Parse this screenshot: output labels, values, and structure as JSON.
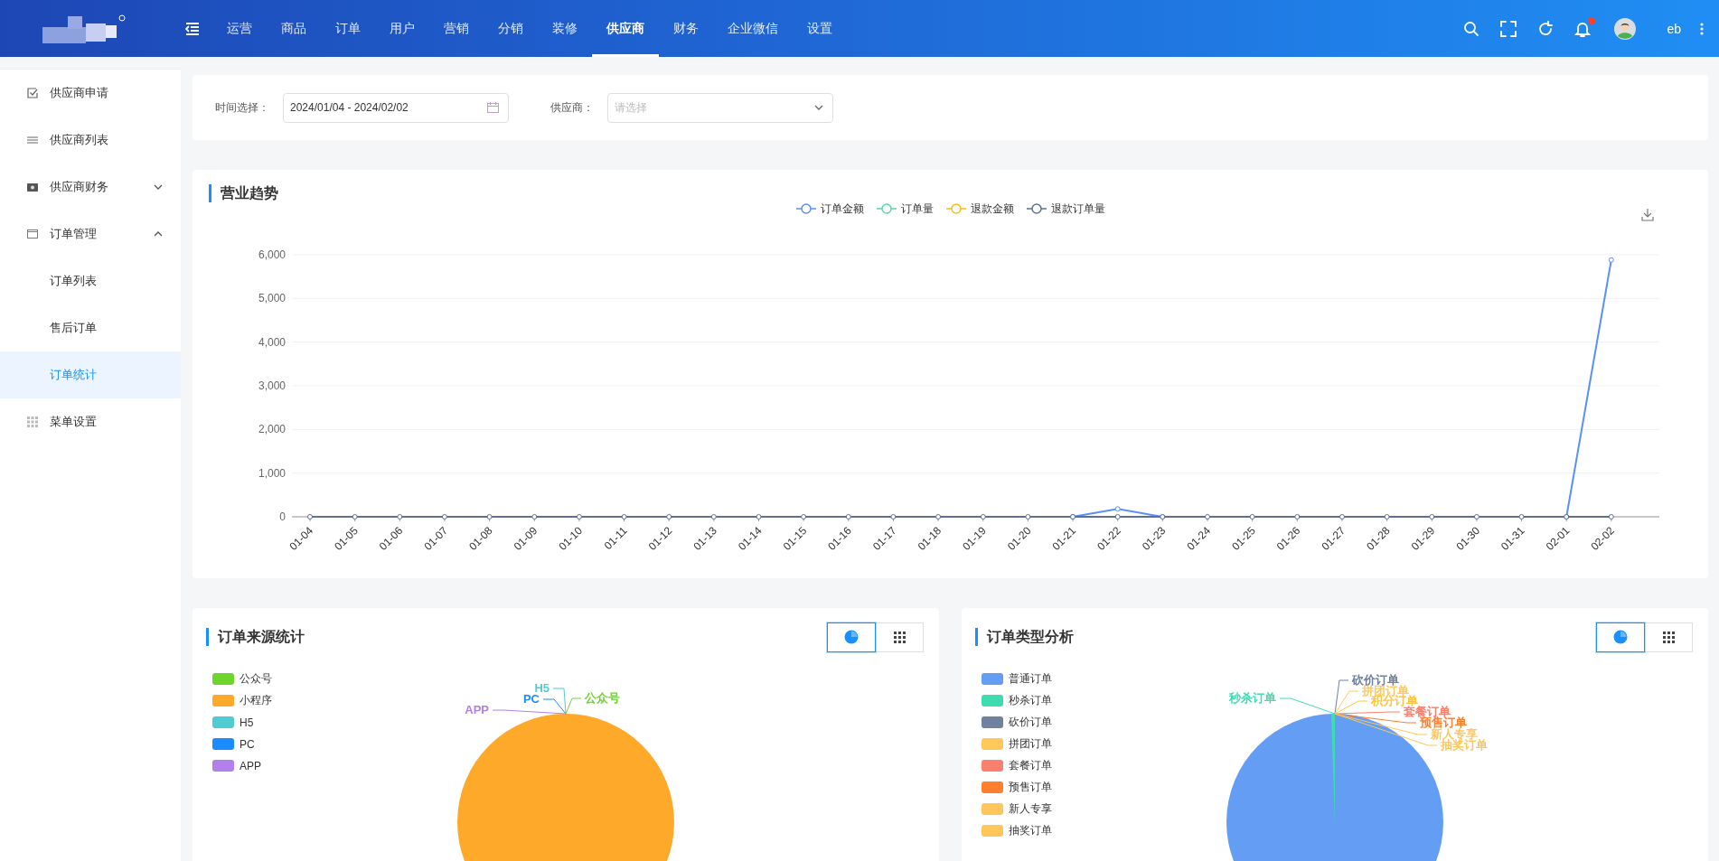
{
  "topbar": {
    "nav": [
      {
        "label": "运营",
        "selected": false
      },
      {
        "label": "商品",
        "selected": false
      },
      {
        "label": "订单",
        "selected": false
      },
      {
        "label": "用户",
        "selected": false
      },
      {
        "label": "营销",
        "selected": false
      },
      {
        "label": "分销",
        "selected": false
      },
      {
        "label": "装修",
        "selected": false
      },
      {
        "label": "供应商",
        "selected": true
      },
      {
        "label": "财务",
        "selected": false
      },
      {
        "label": "企业微信",
        "selected": false
      },
      {
        "label": "设置",
        "selected": false
      }
    ],
    "has_unread": true,
    "user": {
      "name": "eb"
    }
  },
  "sidebar": {
    "items": [
      {
        "label": "供应商申请",
        "selected": false
      },
      {
        "label": "供应商列表",
        "selected": false
      },
      {
        "label": "供应商财务",
        "selected": false,
        "expanded": false
      },
      {
        "label": "订单管理",
        "selected": false,
        "expanded": true,
        "children": [
          {
            "label": "订单列表",
            "selected": false
          },
          {
            "label": "售后订单",
            "selected": false
          },
          {
            "label": "订单统计",
            "selected": true
          }
        ]
      },
      {
        "label": "菜单设置",
        "selected": false
      }
    ]
  },
  "filters": {
    "date_range": {
      "label": "时间选择：",
      "value": "2024/01/04 - 2024/02/02"
    },
    "supplier": {
      "label": "供应商：",
      "placeholder": "请选择"
    }
  },
  "trend": {
    "title": "营业趋势",
    "chart_data": {
      "type": "line",
      "categories": [
        "01-04",
        "01-05",
        "01-06",
        "01-07",
        "01-08",
        "01-09",
        "01-10",
        "01-11",
        "01-12",
        "01-13",
        "01-14",
        "01-15",
        "01-16",
        "01-17",
        "01-18",
        "01-19",
        "01-20",
        "01-21",
        "01-22",
        "01-23",
        "01-24",
        "01-25",
        "01-26",
        "01-27",
        "01-28",
        "01-29",
        "01-30",
        "01-31",
        "02-01",
        "02-02"
      ],
      "series": [
        {
          "name": "订单金额",
          "color": "#5b8ff9",
          "marker": true,
          "values": [
            null,
            null,
            null,
            null,
            null,
            null,
            null,
            null,
            null,
            null,
            null,
            null,
            null,
            null,
            null,
            null,
            null,
            0,
            180,
            0,
            null,
            null,
            null,
            null,
            null,
            null,
            null,
            null,
            0,
            5880
          ]
        },
        {
          "name": "订单量",
          "color": "#5ad8a6",
          "values": [
            null,
            null,
            null,
            null,
            null,
            null,
            null,
            null,
            null,
            null,
            null,
            null,
            null,
            null,
            null,
            null,
            null,
            null,
            null,
            null,
            null,
            null,
            null,
            null,
            null,
            null,
            null,
            null,
            null,
            null
          ]
        },
        {
          "name": "退款金额",
          "color": "#f6bd16",
          "values": [
            null,
            null,
            null,
            null,
            null,
            null,
            null,
            null,
            null,
            null,
            null,
            null,
            null,
            null,
            null,
            null,
            null,
            null,
            null,
            null,
            null,
            null,
            null,
            null,
            null,
            null,
            null,
            null,
            null,
            null
          ]
        },
        {
          "name": "退款订单量",
          "color": "#5d7092",
          "marker": true,
          "values": [
            0,
            0,
            0,
            0,
            0,
            0,
            0,
            0,
            0,
            0,
            0,
            0,
            0,
            0,
            0,
            0,
            0,
            0,
            0,
            0,
            0,
            0,
            0,
            0,
            0,
            0,
            0,
            0,
            0,
            0
          ]
        }
      ],
      "grid": true,
      "ylim": [
        0,
        6000
      ],
      "yticks": [
        {
          "value": 0,
          "label": "0"
        },
        {
          "value": 1000,
          "label": "1,000"
        },
        {
          "value": 2000,
          "label": "2,000"
        },
        {
          "value": 3000,
          "label": "3,000"
        },
        {
          "value": 4000,
          "label": "4,000"
        },
        {
          "value": 5000,
          "label": "5,000"
        },
        {
          "value": 6000,
          "label": "6,000"
        }
      ]
    }
  },
  "pies": [
    {
      "title": "订单来源统计",
      "view_modes": [
        {
          "kind": "pie",
          "selected": true
        },
        {
          "kind": "grid",
          "selected": false
        }
      ],
      "legend": [
        {
          "label": "公众号",
          "color": "#6dd52e"
        },
        {
          "label": "小程序",
          "color": "#fea92a"
        },
        {
          "label": "H5",
          "color": "#4fcbd6"
        },
        {
          "label": "PC",
          "color": "#1a8cfe"
        },
        {
          "label": "APP",
          "color": "#b37feb"
        }
      ],
      "callouts": [
        {
          "label": "APP",
          "color": "#b37feb"
        },
        {
          "label": "H5",
          "color": "#4fcbd6"
        },
        {
          "label": "PC",
          "color": "#1a8cfe"
        },
        {
          "label": "公众号",
          "color": "#6dd52e"
        }
      ]
    },
    {
      "title": "订单类型分析",
      "view_modes": [
        {
          "kind": "pie",
          "selected": true
        },
        {
          "kind": "grid",
          "selected": false
        }
      ],
      "legend": [
        {
          "label": "普通订单",
          "color": "#639ef4"
        },
        {
          "label": "秒杀订单",
          "color": "#3fdcb1"
        },
        {
          "label": "砍价订单",
          "color": "#6f819e"
        },
        {
          "label": "拼团订单",
          "color": "#ffc85a"
        },
        {
          "label": "套餐订单",
          "color": "#fd7f6e"
        },
        {
          "label": "预售订单",
          "color": "#ff7f2e"
        },
        {
          "label": "新人专享",
          "color": "#ffc75b"
        },
        {
          "label": "抽奖订单",
          "color": "#ffc65c"
        }
      ],
      "callouts": [
        {
          "label": "秒杀订单",
          "color": "#3fdcb1"
        },
        {
          "label": "砍价订单",
          "color": "#6f819e"
        },
        {
          "label": "拼团订单",
          "color": "#ffc85a"
        },
        {
          "label": "积分订单",
          "color": "#ffc443"
        },
        {
          "label": "套餐订单",
          "color": "#fd7f6e"
        },
        {
          "label": "预售订单",
          "color": "#ff7f2e"
        },
        {
          "label": "新人专享",
          "color": "#ffc75b"
        },
        {
          "label": "抽奖订单",
          "color": "#ffc65c"
        }
      ]
    }
  ]
}
